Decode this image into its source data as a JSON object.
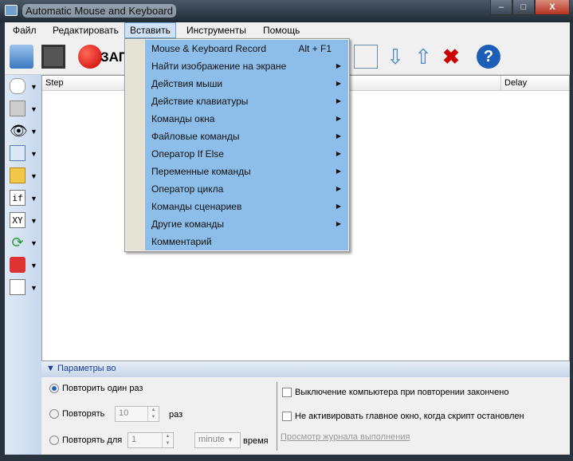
{
  "window": {
    "title": "Automatic Mouse and Keyboard",
    "min": "–",
    "max": "□",
    "close": "X"
  },
  "menubar": [
    "Файл",
    "Редактировать",
    "Вставить",
    "Инструменты",
    "Помощь"
  ],
  "toolbar": {
    "record_label": "ЗАП"
  },
  "grid": {
    "columns": [
      "Step",
      "Delay"
    ]
  },
  "insert_menu": [
    {
      "label": "Mouse & Keyboard Record",
      "shortcut": "Alt + F1"
    },
    {
      "label": "Найти изображение на экране",
      "sub": true
    },
    {
      "label": "Действия мыши",
      "sub": true
    },
    {
      "label": "Действие клавиатуры",
      "sub": true
    },
    {
      "label": "Команды окна",
      "sub": true
    },
    {
      "label": "Файловые команды",
      "sub": true
    },
    {
      "label": "Оператор If Else",
      "sub": true
    },
    {
      "label": "Переменные команды",
      "sub": true
    },
    {
      "label": "Оператор цикла",
      "sub": true
    },
    {
      "label": "Команды сценариев",
      "sub": true
    },
    {
      "label": "Другие команды",
      "sub": true
    },
    {
      "label": "Комментарий"
    }
  ],
  "left_tools": [
    "if",
    "XY"
  ],
  "params": {
    "header": "Параметры во",
    "repeat_once": "Повторить один раз",
    "repeat": "Повторять",
    "repeat_count": "10",
    "times": "раз",
    "repeat_for": "Повторять для",
    "duration": "1",
    "unit": "minute",
    "time": "время",
    "shutdown": "Выключение компьютера при повторении закончено",
    "no_activate": "Не активировать главное окно, когда скрипт остановлен",
    "log_link": "Просмотр журнала выполнения"
  }
}
